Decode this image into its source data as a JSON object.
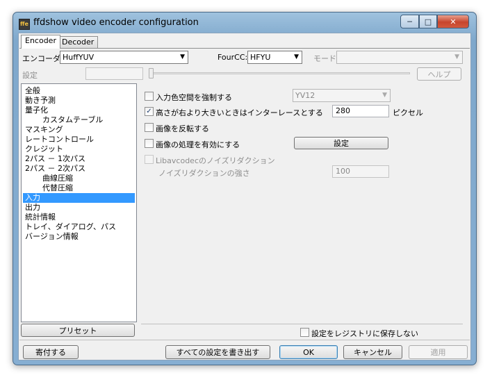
{
  "window": {
    "title": "ffdshow video encoder configuration",
    "app_icon_text": "ffe"
  },
  "caption": {
    "minimize": "─",
    "maximize": "□",
    "close": "✕"
  },
  "tabs": [
    {
      "label": "Encoder"
    },
    {
      "label": "Decoder"
    }
  ],
  "top": {
    "encoder_label": "エンコーダ",
    "encoder_value": "HuffYUV",
    "fourcc_label": "FourCC:",
    "fourcc_value": "HFYU",
    "mode_label": "モード:",
    "mode_value": "",
    "settings_label": "設定",
    "help_button": "ヘルプ"
  },
  "sidebar": {
    "items": [
      {
        "label": "全般",
        "sub": false
      },
      {
        "label": "動き予測",
        "sub": false
      },
      {
        "label": "量子化",
        "sub": false
      },
      {
        "label": "カスタムテーブル",
        "sub": true
      },
      {
        "label": "マスキング",
        "sub": false
      },
      {
        "label": "レートコントロール",
        "sub": false
      },
      {
        "label": "クレジット",
        "sub": false
      },
      {
        "label": "2パス － 1次パス",
        "sub": false
      },
      {
        "label": "2パス － 2次パス",
        "sub": false
      },
      {
        "label": "曲線圧縮",
        "sub": true
      },
      {
        "label": "代替圧縮",
        "sub": true
      },
      {
        "label": "入力",
        "sub": false,
        "selected": true
      },
      {
        "label": "出力",
        "sub": false
      },
      {
        "label": "統計情報",
        "sub": false
      },
      {
        "label": "トレイ、ダイアログ、パス",
        "sub": false
      },
      {
        "label": "バージョン情報",
        "sub": false
      }
    ],
    "preset_button": "プリセット"
  },
  "panel": {
    "force_colorspace_label": "入力色空間を強制する",
    "force_colorspace_checked": false,
    "colorspace_value": "YV12",
    "interlace_label": "高さが右より大きいときはインターレースとする",
    "interlace_checked": true,
    "interlace_value": "280",
    "interlace_unit": "ピクセル",
    "flip_label": "画像を反転する",
    "flip_checked": false,
    "processing_label": "画像の処理を有効にする",
    "processing_checked": false,
    "processing_settings_button": "設定",
    "noise_label": "Libavcodecのノイズリダクション",
    "noise_checked": false,
    "noise_strength_label": "ノイズリダクションの強さ",
    "noise_strength_value": "100",
    "registry_label": "設定をレジストリに保存しない",
    "registry_checked": false
  },
  "bottom": {
    "donate_button": "寄付する",
    "export_button": "すべての設定を書き出す",
    "ok_button": "OK",
    "cancel_button": "キャンセル",
    "apply_button": "適用"
  }
}
